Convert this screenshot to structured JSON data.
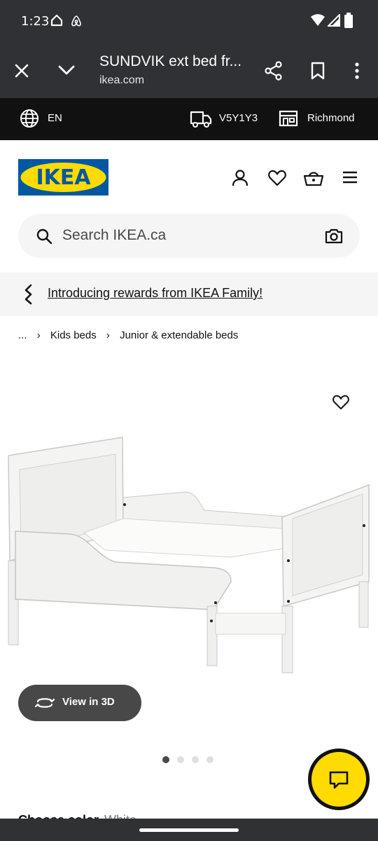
{
  "status_bar": {
    "time": "1:23",
    "left_icons": [
      "home-icon",
      "airbnb-icon"
    ],
    "right_icons": [
      "wifi-icon",
      "signal-icon",
      "battery-icon"
    ]
  },
  "tab_bar": {
    "title": "SUNDVIK ext bed fr...",
    "url": "ikea.com",
    "icons": [
      "close-icon",
      "chevron-down-icon",
      "share-icon",
      "bookmark-icon",
      "more-vert-icon"
    ]
  },
  "top_strip": {
    "language": "EN",
    "postal_code": "V5Y1Y3",
    "store": "Richmond"
  },
  "header": {
    "logo_text": "IKEA",
    "icons": [
      "account-icon",
      "heart-icon",
      "cart-icon",
      "menu-icon"
    ]
  },
  "search": {
    "placeholder": "Search IKEA.ca"
  },
  "promo": {
    "text": "Introducing rewards from IKEA Family!"
  },
  "breadcrumbs": [
    "...",
    "Kids beds",
    "Junior & extendable beds"
  ],
  "product": {
    "view_3d_label": "View in 3D",
    "image_count": 4,
    "active_image": 0,
    "peek_title": "Choose color",
    "peek_value": "White"
  },
  "colors": {
    "chrome": "#303134",
    "strip": "#111111",
    "ikea_blue": "#0058a3",
    "ikea_yellow": "#ffdb00",
    "dot_active": "#484848",
    "dot_inactive": "#dfdfdf"
  }
}
